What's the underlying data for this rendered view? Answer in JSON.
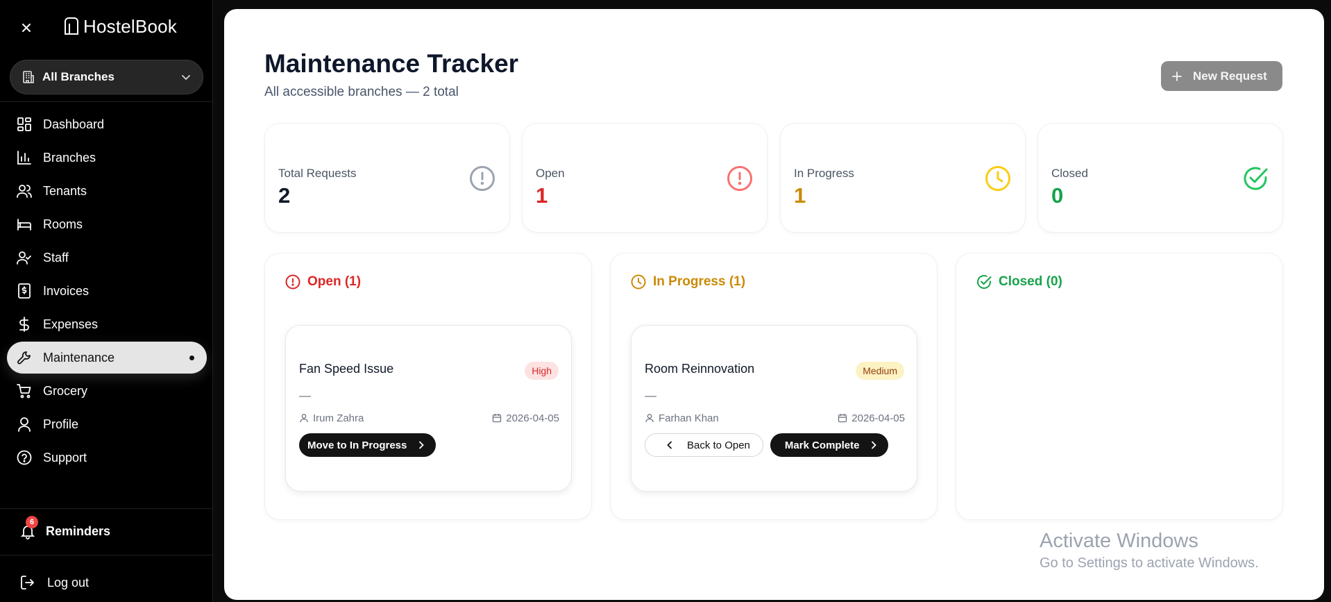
{
  "sidebar": {
    "brand": "HostelBook",
    "branch_select": "All Branches",
    "items": [
      {
        "label": "Dashboard",
        "icon": "dashboard-icon"
      },
      {
        "label": "Branches",
        "icon": "bar-chart-icon"
      },
      {
        "label": "Tenants",
        "icon": "users-icon"
      },
      {
        "label": "Rooms",
        "icon": "bed-icon"
      },
      {
        "label": "Staff",
        "icon": "user-check-icon"
      },
      {
        "label": "Invoices",
        "icon": "receipt-icon"
      },
      {
        "label": "Expenses",
        "icon": "dollar-icon"
      },
      {
        "label": "Maintenance",
        "icon": "wrench-icon",
        "active": true
      },
      {
        "label": "Grocery",
        "icon": "cart-icon"
      },
      {
        "label": "Profile",
        "icon": "user-icon"
      },
      {
        "label": "Support",
        "icon": "help-circle-icon"
      }
    ],
    "reminders": {
      "label": "Reminders",
      "count": "6"
    },
    "logout": "Log out"
  },
  "header": {
    "title": "Maintenance Tracker",
    "subtitle": "All accessible branches — 2 total",
    "new_request": "New Request"
  },
  "stats": [
    {
      "label": "Total Requests",
      "value": "2",
      "icon": "alert-circle-icon",
      "color": "#111827",
      "icon_color": "#9ca3af"
    },
    {
      "label": "Open",
      "value": "1",
      "icon": "alert-circle-icon",
      "color": "#dc2626",
      "icon_color": "#f87171"
    },
    {
      "label": "In Progress",
      "value": "1",
      "icon": "clock-icon",
      "color": "#ca8a04",
      "icon_color": "#facc15"
    },
    {
      "label": "Closed",
      "value": "0",
      "icon": "check-circle-icon",
      "color": "#16a34a",
      "icon_color": "#22c55e"
    }
  ],
  "columns": {
    "open": {
      "title": "Open (1)",
      "color": "#dc2626",
      "card": {
        "title": "Fan Speed Issue",
        "priority": "High",
        "description": "—",
        "assignee": "Irum Zahra",
        "date": "2026-04-05",
        "primary_action": "Move to In Progress"
      }
    },
    "in_progress": {
      "title": "In Progress (1)",
      "color": "#ca8a04",
      "card": {
        "title": "Room Reinnovation",
        "priority": "Medium",
        "description": "—",
        "assignee": "Farhan Khan",
        "date": "2026-04-05",
        "secondary_action": "Back to Open",
        "primary_action": "Mark Complete"
      }
    },
    "closed": {
      "title": "Closed (0)",
      "color": "#16a34a"
    }
  },
  "watermark": {
    "line1": "Activate Windows",
    "line2": "Go to Settings to activate Windows."
  }
}
